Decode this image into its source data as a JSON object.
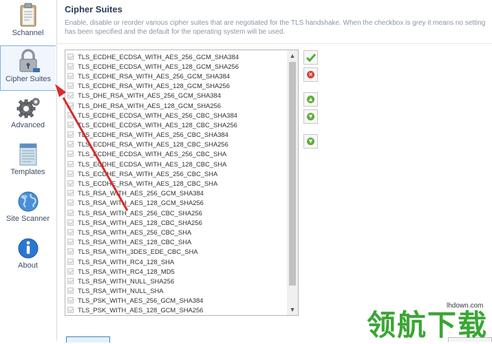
{
  "sidebar": {
    "items": [
      {
        "label": "Schannel",
        "icon": "clipboard-icon"
      },
      {
        "label": "Cipher Suites",
        "icon": "padlock-icon",
        "active": true
      },
      {
        "label": "Advanced",
        "icon": "gear-icon"
      },
      {
        "label": "Templates",
        "icon": "document-icon"
      },
      {
        "label": "Site Scanner",
        "icon": "globe-icon"
      },
      {
        "label": "About",
        "icon": "info-icon"
      }
    ]
  },
  "header": {
    "title": "Cipher Suites",
    "description": "Enable, disable or reorder various cipher suites that are negotiated for the TLS handshake. When the checkbox is grey it means no setting has been specified and the default for the operating system will be used."
  },
  "cipher_list": [
    "TLS_ECDHE_ECDSA_WITH_AES_256_GCM_SHA384",
    "TLS_ECDHE_ECDSA_WITH_AES_128_GCM_SHA256",
    "TLS_ECDHE_RSA_WITH_AES_256_GCM_SHA384",
    "TLS_ECDHE_RSA_WITH_AES_128_GCM_SHA256",
    "TLS_DHE_RSA_WITH_AES_256_GCM_SHA384",
    "TLS_DHE_RSA_WITH_AES_128_GCM_SHA256",
    "TLS_ECDHE_ECDSA_WITH_AES_256_CBC_SHA384",
    "TLS_ECDHE_ECDSA_WITH_AES_128_CBC_SHA256",
    "TLS_ECDHE_RSA_WITH_AES_256_CBC_SHA384",
    "TLS_ECDHE_RSA_WITH_AES_128_CBC_SHA256",
    "TLS_ECDHE_ECDSA_WITH_AES_256_CBC_SHA",
    "TLS_ECDHE_ECDSA_WITH_AES_128_CBC_SHA",
    "TLS_ECDHE_RSA_WITH_AES_256_CBC_SHA",
    "TLS_ECDHE_RSA_WITH_AES_128_CBC_SHA",
    "TLS_RSA_WITH_AES_256_GCM_SHA384",
    "TLS_RSA_WITH_AES_128_GCM_SHA256",
    "TLS_RSA_WITH_AES_256_CBC_SHA256",
    "TLS_RSA_WITH_AES_128_CBC_SHA256",
    "TLS_RSA_WITH_AES_256_CBC_SHA",
    "TLS_RSA_WITH_AES_128_CBC_SHA",
    "TLS_RSA_WITH_3DES_EDE_CBC_SHA",
    "TLS_RSA_WITH_RC4_128_SHA",
    "TLS_RSA_WITH_RC4_128_MD5",
    "TLS_RSA_WITH_NULL_SHA256",
    "TLS_RSA_WITH_NULL_SHA",
    "TLS_PSK_WITH_AES_256_GCM_SHA384",
    "TLS_PSK_WITH_AES_128_GCM_SHA256"
  ],
  "side_buttons": [
    {
      "name": "enable-button",
      "icon": "checkmark-icon",
      "color": "#4caf2f"
    },
    {
      "name": "disable-button",
      "icon": "x-circle-icon",
      "color": "#d9443b"
    },
    {
      "name": "move-up-button",
      "icon": "up-arrow-icon",
      "color": "#5aae3c"
    },
    {
      "name": "move-down-button",
      "icon": "down-arrow-icon",
      "color": "#5aae3c"
    },
    {
      "name": "move-bottom-button",
      "icon": "down-arrow-icon",
      "color": "#5aae3c"
    }
  ],
  "watermark": {
    "text": "领航下载",
    "url": "lhdown.com"
  },
  "colors": {
    "accent": "#7fb0e0",
    "annotation_arrow": "#d62b2b"
  }
}
